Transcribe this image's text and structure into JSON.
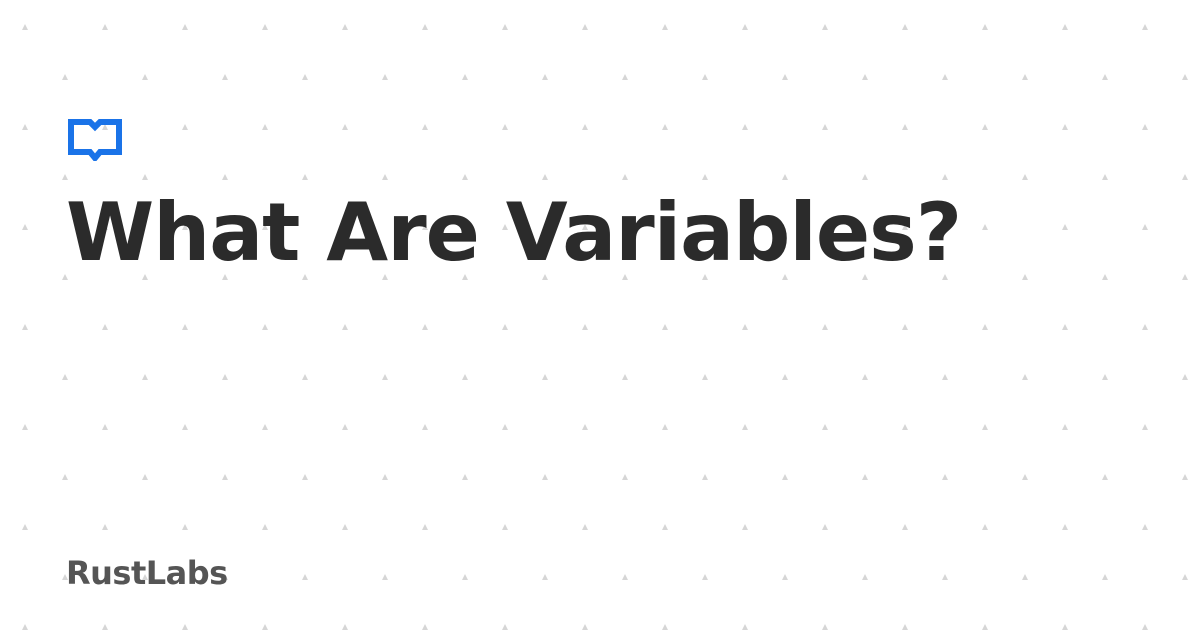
{
  "page": {
    "title": "What Are Variables?",
    "brand": "RustLabs",
    "logo_icon": "open-book-icon"
  },
  "colors": {
    "background": "#ffffff",
    "title": "#2b2b2b",
    "brand": "#555555",
    "accent": "#1a73e8",
    "pattern_dot": "#d6d6d6"
  }
}
